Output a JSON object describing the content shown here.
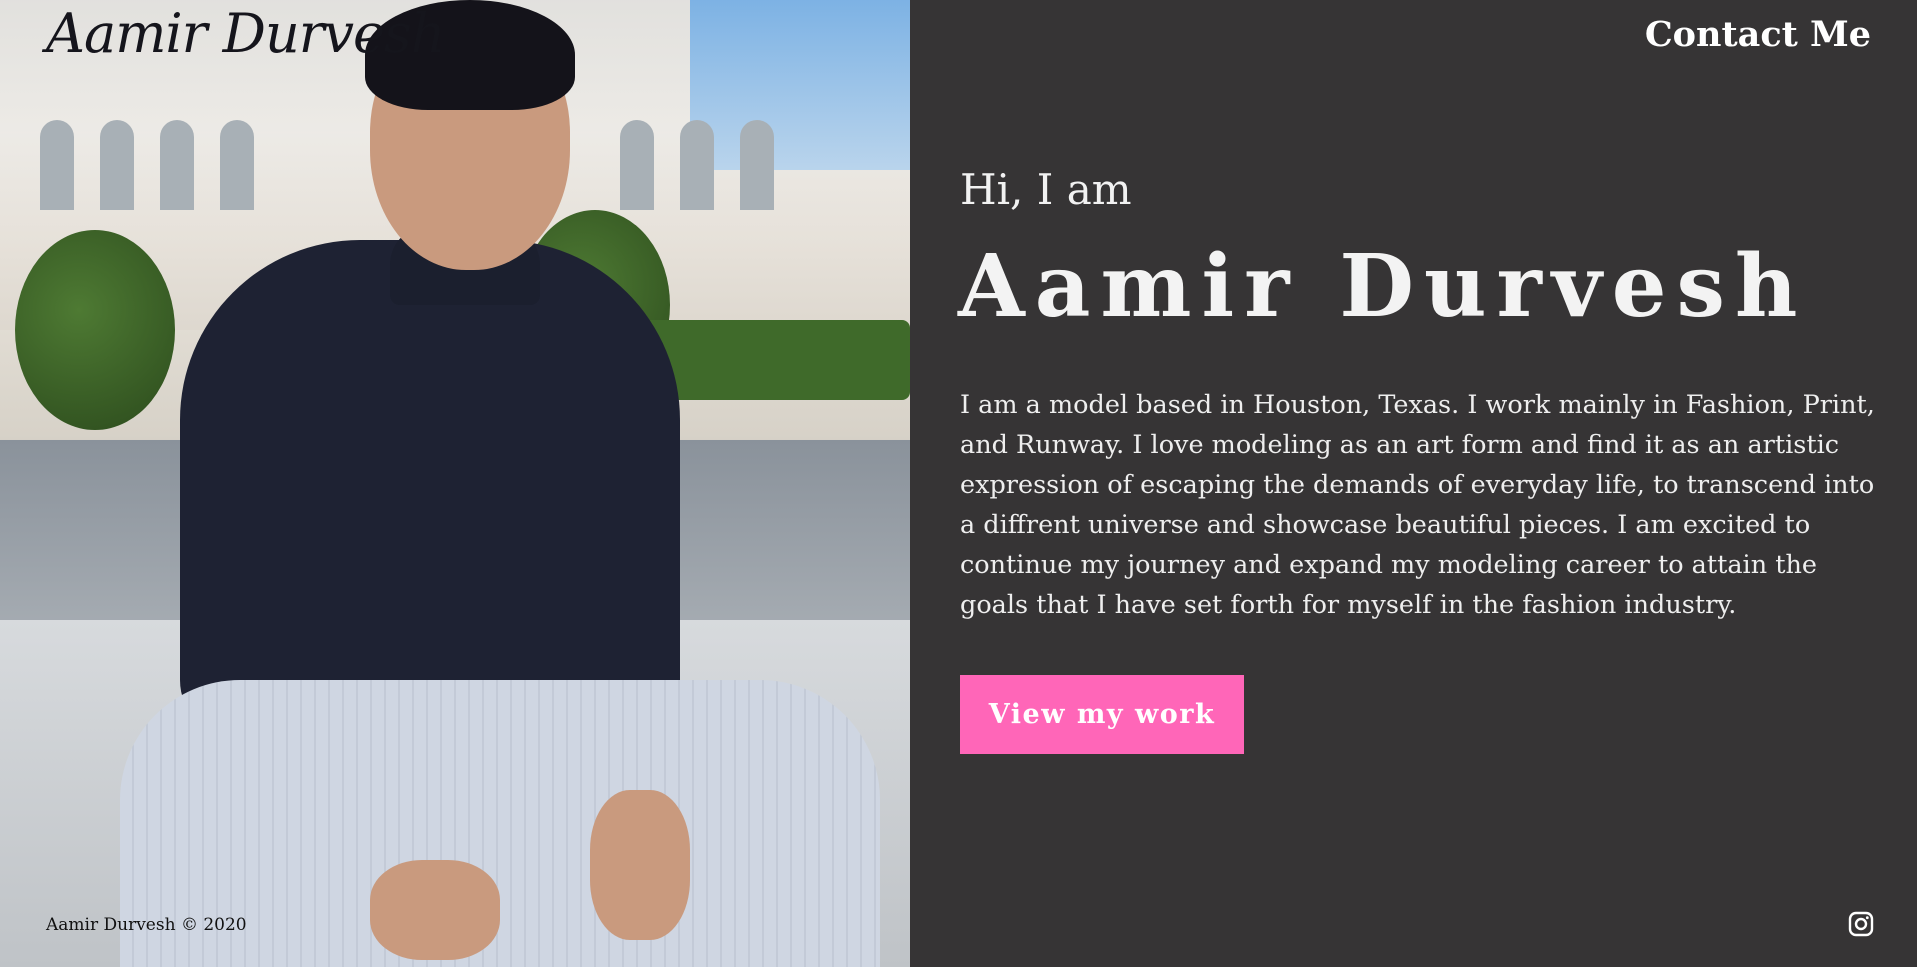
{
  "header": {
    "logo_text": "Aamir Durvesh",
    "contact_label": "Contact Me"
  },
  "hero": {
    "greeting": "Hi, I am",
    "name": "Aamir Durvesh",
    "bio": "I am a model based in Houston, Texas. I work mainly in Fashion, Print, and Runway. I love modeling as an art form and find it as an artistic expression of escaping the demands of everyday life, to transcend into a diffrent universe and showcase beautiful pieces. I am excited to continue my journey and expand my modeling career to attain the goals that I have set forth for myself in the fashion industry.",
    "cta_label": "View my work"
  },
  "footer": {
    "copyright": "Aamir Durvesh © 2020",
    "social_icon": "instagram-icon"
  },
  "colors": {
    "panel_bg": "#363435",
    "accent": "#ff66b8",
    "text": "#ffffff"
  }
}
